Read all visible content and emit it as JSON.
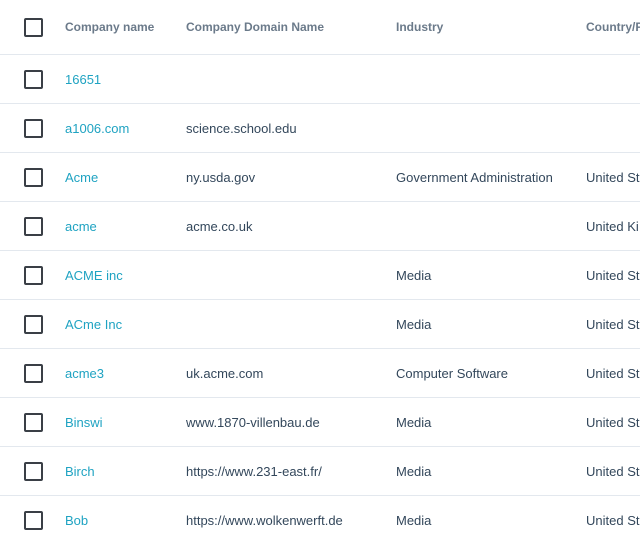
{
  "columns": {
    "company_name": "Company name",
    "domain": "Company Domain Name",
    "industry": "Industry",
    "country": "Country/R"
  },
  "rows": [
    {
      "name": "16651",
      "domain": "",
      "industry": "",
      "country": ""
    },
    {
      "name": "a1006.com",
      "domain": "science.school.edu",
      "industry": "",
      "country": ""
    },
    {
      "name": "Acme",
      "domain": "ny.usda.gov",
      "industry": "Government Administration",
      "country": "United St"
    },
    {
      "name": "acme",
      "domain": "acme.co.uk",
      "industry": "",
      "country": "United Ki"
    },
    {
      "name": "ACME inc",
      "domain": "",
      "industry": "Media",
      "country": "United St"
    },
    {
      "name": "ACme Inc",
      "domain": "",
      "industry": "Media",
      "country": "United St"
    },
    {
      "name": "acme3",
      "domain": "uk.acme.com",
      "industry": "Computer Software",
      "country": "United St"
    },
    {
      "name": "Binswi",
      "domain": "www.1870-villenbau.de",
      "industry": "Media",
      "country": "United St"
    },
    {
      "name": "Birch",
      "domain": "https://www.231-east.fr/",
      "industry": "Media",
      "country": "United St"
    },
    {
      "name": "Bob",
      "domain": "https://www.wolkenwerft.de",
      "industry": "Media",
      "country": "United St"
    }
  ]
}
